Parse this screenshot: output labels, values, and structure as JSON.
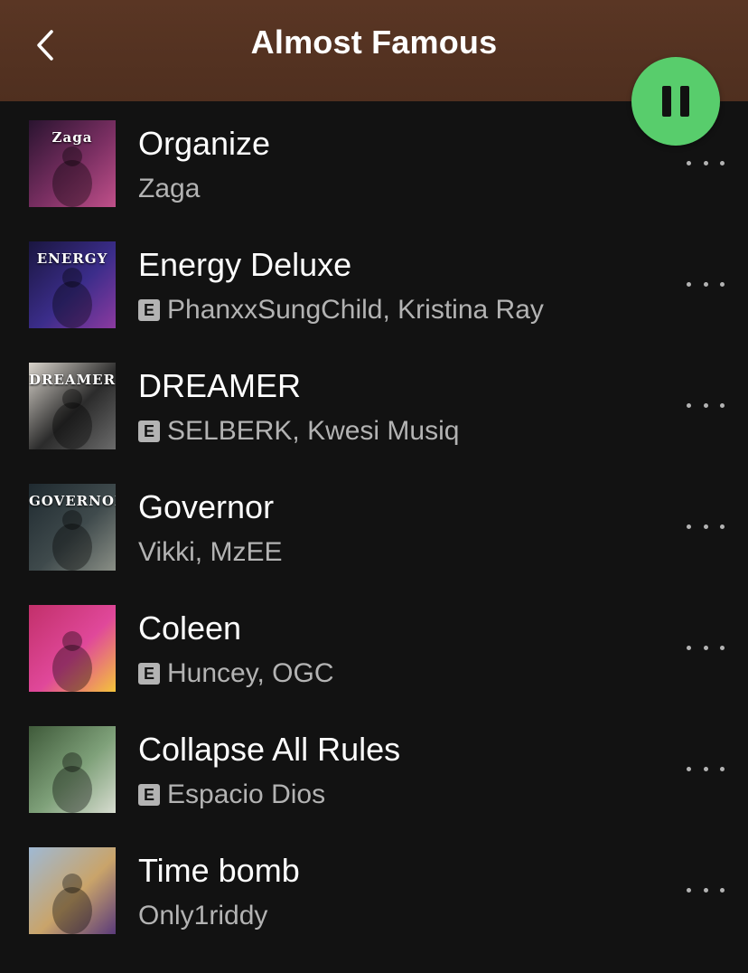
{
  "header": {
    "title": "Almost Famous",
    "back_icon": "chevron-left-icon",
    "play_state_icon": "pause-icon",
    "play_color": "#58cd6c",
    "background": "#543321"
  },
  "tracks": [
    {
      "title": "Organize",
      "artist": "Zaga",
      "explicit": false,
      "art_text": "Zaga",
      "art_colors": [
        "#2a1430",
        "#7a2f62",
        "#c0508a"
      ]
    },
    {
      "title": "Energy Deluxe",
      "artist": "PhanxxSungChild, Kristina Ray",
      "explicit": true,
      "explicit_label": "E",
      "art_text": "ENERGY",
      "art_colors": [
        "#1a1640",
        "#3b2d8a",
        "#8c3aa0"
      ]
    },
    {
      "title": "DREAMER",
      "artist": "SELBERK, Kwesi Musiq",
      "explicit": true,
      "explicit_label": "E",
      "art_text": "DREAMER",
      "art_colors": [
        "#d9d4cc",
        "#2b2b2b",
        "#6b6b6b"
      ]
    },
    {
      "title": "Governor",
      "artist": "Vikki, MzEE",
      "explicit": false,
      "art_text": "GOVERNOR",
      "art_colors": [
        "#1f2a30",
        "#3f4a4c",
        "#8a8f86"
      ]
    },
    {
      "title": "Coleen",
      "artist": "Huncey, OGC",
      "explicit": true,
      "explicit_label": "E",
      "art_text": "",
      "art_colors": [
        "#c2306a",
        "#e0489a",
        "#f4c43a"
      ]
    },
    {
      "title": "Collapse All Rules",
      "artist": "Espacio Dios",
      "explicit": true,
      "explicit_label": "E",
      "art_text": "",
      "art_colors": [
        "#3f5a3a",
        "#7fa17a",
        "#d7dcd0"
      ]
    },
    {
      "title": "Time bomb",
      "artist": "Only1riddy",
      "explicit": false,
      "art_text": "",
      "art_colors": [
        "#9fb9d4",
        "#c9a46a",
        "#5a3a7a"
      ]
    }
  ],
  "more_icon": "more-horizontal-icon"
}
